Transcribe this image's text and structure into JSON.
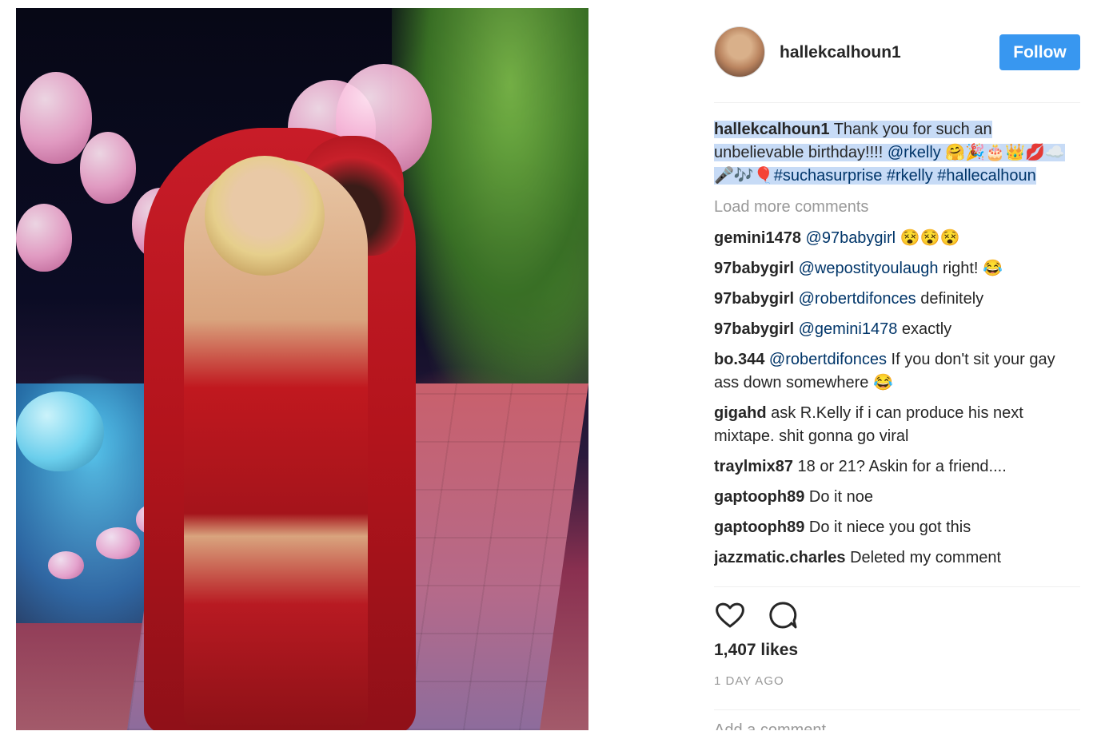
{
  "post": {
    "username": "hallekcalhoun1",
    "follow_label": "Follow",
    "caption": {
      "username": "hallekcalhoun1",
      "text_1": " Thank you for such an unbelievable birthday!!!! ",
      "mention": "@rkelly",
      "emoji_1": " 🤗🎉🎂👑💋☁️🎤🎶🎈",
      "tags": "#suchasurprise #rkelly #hallecalhoun"
    },
    "load_more": "Load more comments",
    "comments": [
      {
        "user": "gemini1478",
        "mention": "@97babygirl",
        "text": " 😵😵😵"
      },
      {
        "user": "97babygirl",
        "mention": "@wepostityoulaugh",
        "text": " right! 😂"
      },
      {
        "user": "97babygirl",
        "mention": "@robertdifonces",
        "text": " definitely"
      },
      {
        "user": "97babygirl",
        "mention": "@gemini1478",
        "text": " exactly"
      },
      {
        "user": "bo.344",
        "mention": "@robertdifonces",
        "text": " If you don't sit your gay ass down somewhere 😂"
      },
      {
        "user": "gigahd",
        "mention": "",
        "text": " ask R.Kelly if i can produce his next mixtape. shit gonna go viral"
      },
      {
        "user": "traylmix87",
        "mention": "",
        "text": " 18 or 21? Askin for a friend...."
      },
      {
        "user": "gaptooph89",
        "mention": "",
        "text": " Do it noe"
      },
      {
        "user": "gaptooph89",
        "mention": "",
        "text": " Do it niece you got this"
      },
      {
        "user": "jazzmatic.charles",
        "mention": "",
        "text": " Deleted my comment"
      }
    ],
    "likes": "1,407 likes",
    "time": "1 DAY AGO",
    "add_comment_placeholder": "Add a comment..."
  },
  "icons": {
    "like": "heart-icon",
    "comment": "speech-bubble-icon"
  }
}
